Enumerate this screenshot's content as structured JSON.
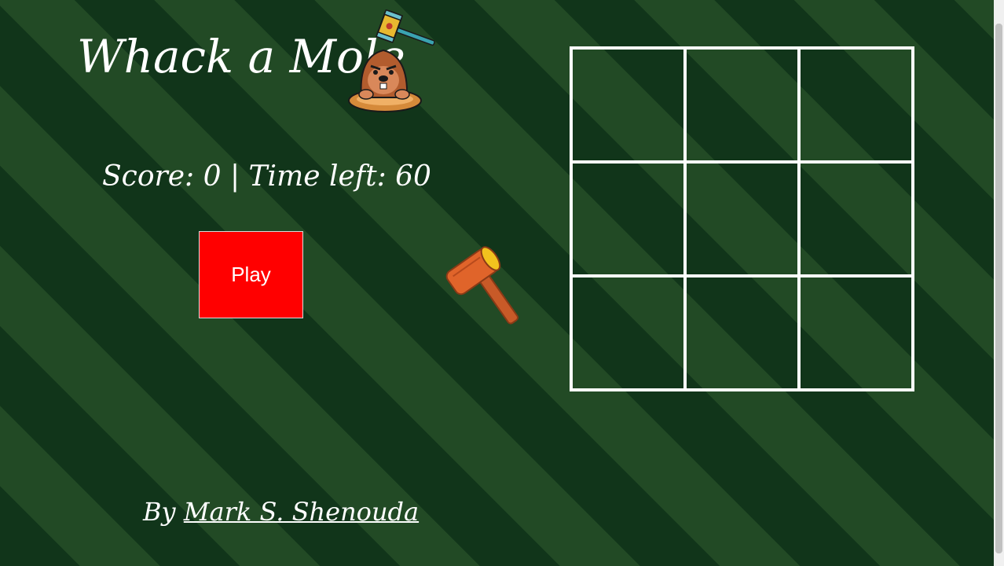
{
  "header": {
    "title": "Whack a Mole"
  },
  "status": {
    "score_label": "Score:",
    "score_value": "0",
    "separator": "|",
    "time_label": "Time left:",
    "time_value": "60"
  },
  "controls": {
    "play_label": "Play"
  },
  "board": {
    "rows": 3,
    "cols": 3,
    "holes": 9
  },
  "footer": {
    "by_label": "By",
    "author_link": "Mark S. Shenouda"
  },
  "colors": {
    "background_dark": "#11351a",
    "background_light": "#224a25",
    "play_button": "#ff0000",
    "grid_lines": "#ffffff",
    "text": "#ffffff"
  },
  "icons": {
    "logo": "mole-with-mallet-icon",
    "cursor": "wooden-hammer-icon"
  }
}
